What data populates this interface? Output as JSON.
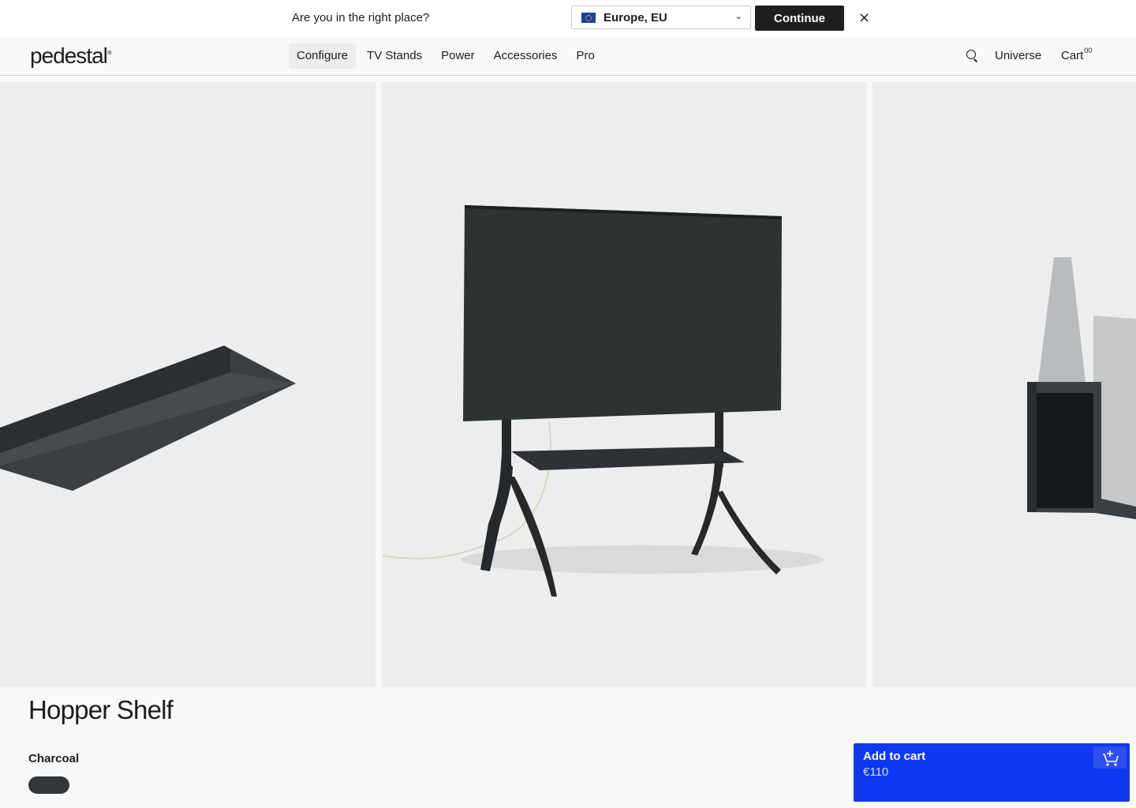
{
  "region_banner": {
    "question": "Are you in the right place?",
    "selected_region": "Europe, EU",
    "flag_icon": "eu-flag-icon",
    "continue_label": "Continue",
    "close_label": "×"
  },
  "header": {
    "logo_text": "pedestal",
    "logo_mark": "®",
    "nav": [
      {
        "label": "Configure",
        "active": true
      },
      {
        "label": "TV Stands",
        "active": false
      },
      {
        "label": "Power",
        "active": false
      },
      {
        "label": "Accessories",
        "active": false
      },
      {
        "label": "Pro",
        "active": false
      }
    ],
    "search_icon": "search-icon",
    "universe_label": "Universe",
    "cart_label": "Cart",
    "cart_count": "00"
  },
  "gallery": {
    "images": [
      "shelf-angle-view",
      "tv-stand-with-shelf",
      "shelf-profile-closeup"
    ]
  },
  "product": {
    "title": "Hopper Shelf",
    "color_name": "Charcoal",
    "swatch_color": "#33373b"
  },
  "add_to_cart": {
    "label": "Add to cart",
    "price": "€110",
    "icon": "cart-add-icon",
    "background": "#0f38f0"
  }
}
